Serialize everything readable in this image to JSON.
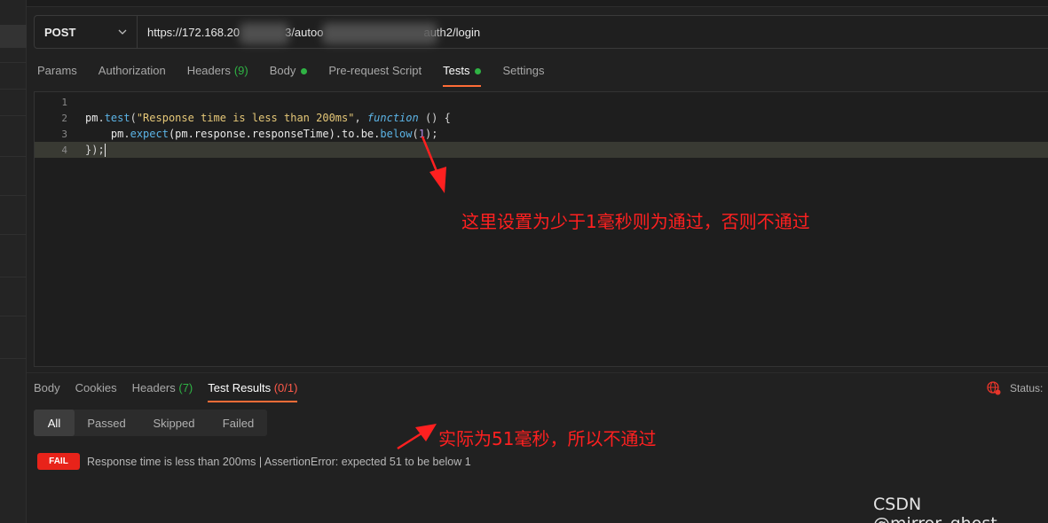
{
  "request": {
    "method": "POST",
    "url_visible_parts": [
      "https://172.168.20",
      "3/autoo",
      "auth2/login"
    ]
  },
  "request_tabs": [
    {
      "label": "Params"
    },
    {
      "label": "Authorization"
    },
    {
      "label": "Headers",
      "count": "(9)"
    },
    {
      "label": "Body",
      "dot": true
    },
    {
      "label": "Pre-request Script"
    },
    {
      "label": "Tests",
      "dot": true,
      "active": true
    },
    {
      "label": "Settings"
    }
  ],
  "editor": {
    "line_numbers": [
      "1",
      "2",
      "3",
      "4"
    ],
    "code": {
      "l2_var": "pm",
      "l2_dot": ".",
      "l2_fn": "test",
      "l2_open": "(",
      "l2_str": "\"Response time is less than 200ms\"",
      "l2_comma": ", ",
      "l2_kw": "function",
      "l2_tail": " () {",
      "l3_indent": "    ",
      "l3_var": "pm",
      "l3_dot": ".",
      "l3_fn": "expect",
      "l3_mid": "(pm.response.responseTime).to.be.",
      "l3_fn2": "below",
      "l3_open": "(",
      "l3_num": "1",
      "l3_close": ");",
      "l4": "});"
    }
  },
  "annotations": {
    "top": "这里设置为少于1毫秒则为通过，否则不通过",
    "bottom": "实际为51毫秒，所以不通过"
  },
  "response_tabs": [
    {
      "label": "Body"
    },
    {
      "label": "Cookies"
    },
    {
      "label": "Headers",
      "count": "(7)"
    },
    {
      "label": "Test Results",
      "count": "(0/1)",
      "active": true
    }
  ],
  "status_label": "Status:",
  "filters": [
    {
      "label": "All",
      "active": true
    },
    {
      "label": "Passed"
    },
    {
      "label": "Skipped"
    },
    {
      "label": "Failed"
    }
  ],
  "result": {
    "badge": "FAIL",
    "text": "Response time is less than 200ms | AssertionError: expected 51 to be below 1"
  },
  "watermark": "CSDN @mirror_ghost",
  "colors": {
    "accent": "#ff6c37",
    "green": "#2fb344",
    "fail": "#e8231a",
    "annotation": "#ff2020"
  }
}
